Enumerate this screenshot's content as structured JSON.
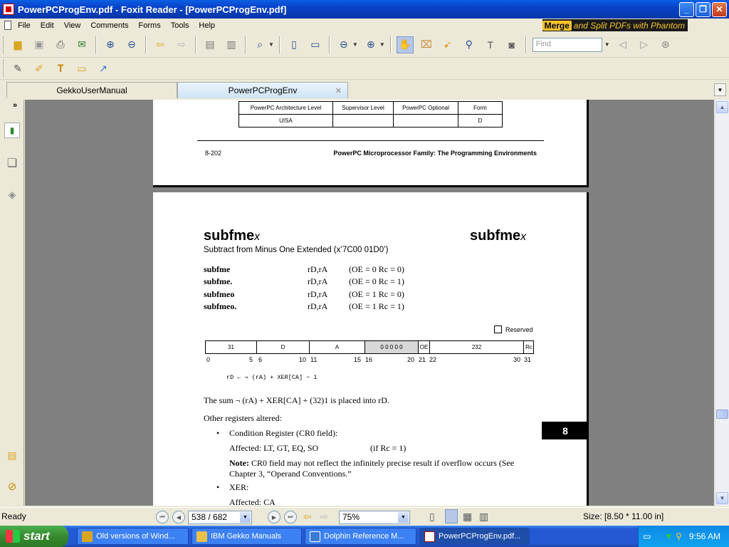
{
  "window": {
    "title": "PowerPCProgEnv.pdf - Foxit Reader - [PowerPCProgEnv.pdf]",
    "minimize": "_",
    "restore": "❐",
    "close": "✕"
  },
  "menu": [
    "File",
    "Edit",
    "View",
    "Comments",
    "Forms",
    "Tools",
    "Help"
  ],
  "banner": {
    "merge": "Merge",
    "rest": "and Split PDFs with Phantom"
  },
  "search": {
    "placeholder": "Find"
  },
  "tabs": [
    {
      "label": "GekkoUserManual",
      "active": false
    },
    {
      "label": "PowerPCProgEnv",
      "active": true
    }
  ],
  "page_prev": {
    "table_headers": [
      "PowerPC Architecture Level",
      "Supervisor Level",
      "PowerPC Optional",
      "Form"
    ],
    "table_row": [
      "UISA",
      "",
      "",
      "D"
    ],
    "footer_left": "8-202",
    "footer_right": "PowerPC Microprocessor Family: The Programming Environments"
  },
  "page": {
    "heading": "subfme",
    "heading_suffix": "x",
    "subtitle": "Subtract from Minus One Extended (x’7C00 01D0’)",
    "syntax": [
      {
        "mnemonic": "subfme",
        "operands": "rD,rA",
        "mode": "(OE = 0 Rc = 0)"
      },
      {
        "mnemonic": "subfme.",
        "operands": "rD,rA",
        "mode": "(OE = 0 Rc = 1)"
      },
      {
        "mnemonic": "subfmeo",
        "operands": "rD,rA",
        "mode": "(OE = 1 Rc = 0)"
      },
      {
        "mnemonic": "subfmeo.",
        "operands": "rD,rA",
        "mode": "(OE = 1 Rc = 1)"
      }
    ],
    "reserved_label": "Reserved",
    "fields": [
      "31",
      "D",
      "A",
      "0 0 0 0 0",
      "OE",
      "232",
      "Rc"
    ],
    "bits": [
      "0",
      "5",
      "6",
      "10",
      "11",
      "15",
      "16",
      "20",
      "21",
      "22",
      "30",
      "31"
    ],
    "pseudocode": "rD ← ¬ (rA) + XER[CA] − 1",
    "description": "The sum ¬ (rA) + XER[CA] + (32)1 is placed into rD.",
    "other_label": "Other registers altered:",
    "bullet1": "Condition Register (CR0 field):",
    "affected1": "Affected: LT, GT, EQ, SO",
    "affected1_cond": "(if Rc = 1)",
    "note_label": "Note:",
    "note_text": "CR0 field may not reflect the infinitely precise result if overflow occurs (See Chapter 3, “Operand Conventions.”",
    "bullet2": "XER:",
    "affected2": "Affected: CA",
    "chapter_tab": "8"
  },
  "status": {
    "ready": "Ready",
    "page": "538 / 682",
    "zoom": "75%",
    "size": "Size: [8.50 * 11.00 in]"
  },
  "taskbar": {
    "start": "start",
    "items": [
      "Old versions of Wind...",
      "IBM Gekko Manuals",
      "Dolphin Reference M...",
      "PowerPCProgEnv.pdf..."
    ],
    "clock": "9:56 AM"
  }
}
